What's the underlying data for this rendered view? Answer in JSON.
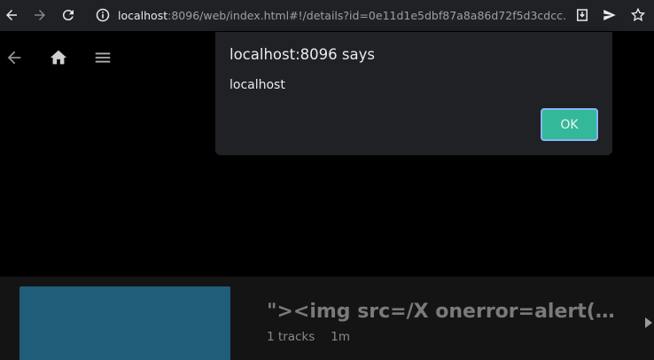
{
  "browser": {
    "url_host": "localhost",
    "url_rest": ":8096/web/index.html#!/details?id=0e11d1e5dbf87a8a86d72f5d3cdcc…"
  },
  "dialog": {
    "title": "localhost:8096 says",
    "message": "localhost",
    "ok_label": "OK"
  },
  "item": {
    "title": "\"><img src=/X onerror=alert(…",
    "tracks": "1 tracks",
    "duration": "1m"
  },
  "colors": {
    "accent": "#34b89a",
    "cover": "#1f5d78",
    "focus_ring": "#8ab4f8"
  }
}
